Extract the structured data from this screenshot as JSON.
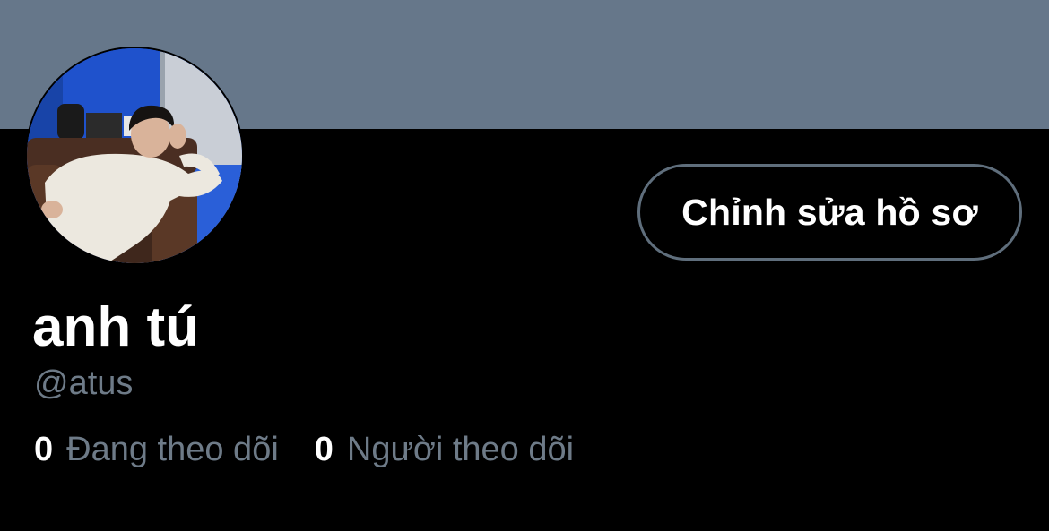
{
  "profile": {
    "display_name": "anh tú",
    "handle": "@atus",
    "edit_button_label": "Chỉnh sửa hồ sơ",
    "avatar_icon": "profile-photo"
  },
  "stats": {
    "following": {
      "count": "0",
      "label": "Đang theo dõi"
    },
    "followers": {
      "count": "0",
      "label": "Người theo dõi"
    }
  },
  "colors": {
    "banner": "#66778a",
    "background": "#000000",
    "secondary_text": "#6e7b88",
    "button_border": "#5f6e7c"
  }
}
